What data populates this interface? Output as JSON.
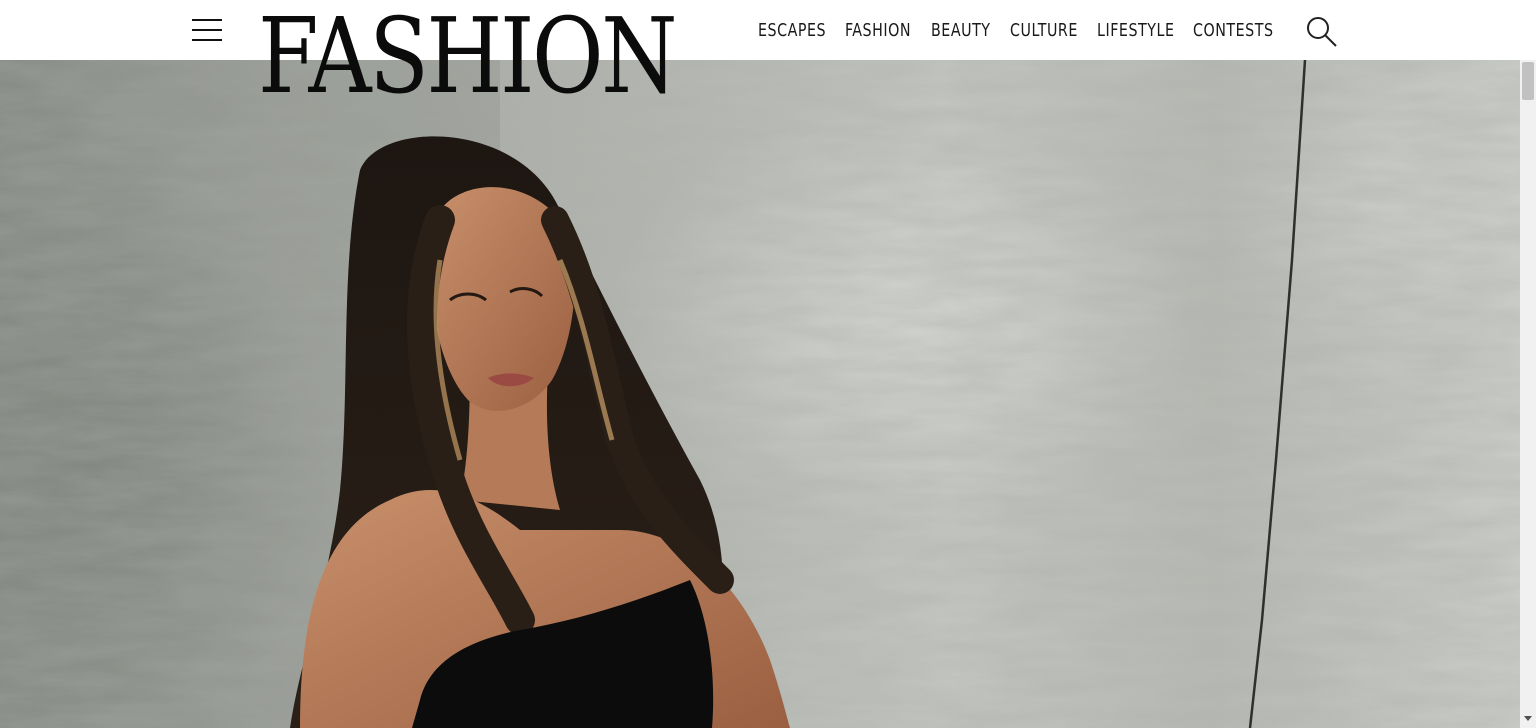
{
  "header": {
    "logo": "FASHION",
    "nav": [
      {
        "label": "ESCAPES"
      },
      {
        "label": "FASHION"
      },
      {
        "label": "BEAUTY"
      },
      {
        "label": "CULTURE"
      },
      {
        "label": "LIFESTYLE"
      },
      {
        "label": "CONTESTS"
      }
    ],
    "icons": {
      "menu": "hamburger-menu-icon",
      "search": "search-icon"
    }
  },
  "hero": {
    "image": "woman-in-black-strapless-top-against-concrete-wall"
  },
  "colors": {
    "header_bg": "#ffffff",
    "text": "#1a1a1a",
    "wall": "#b4b6b1",
    "dress": "#0c0c0c"
  }
}
